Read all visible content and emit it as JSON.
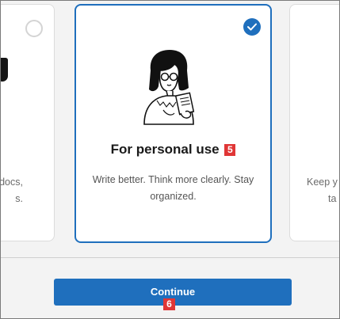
{
  "cards": {
    "left": {
      "desc_line1": "docs,",
      "desc_line2": "s."
    },
    "main": {
      "title": "For personal use",
      "badge": "5",
      "desc": "Write better. Think more clearly. Stay organized."
    },
    "right": {
      "desc_line1": "Keep y",
      "desc_line2": "ta"
    }
  },
  "continue": {
    "label": "Continue",
    "badge": "6"
  },
  "colors": {
    "accent": "#1f6fbd",
    "badge": "#e03636"
  },
  "icons": {
    "selected": "checkmark-icon",
    "unselected": "radio-empty-icon",
    "illustration": "person-writing-illustration"
  }
}
